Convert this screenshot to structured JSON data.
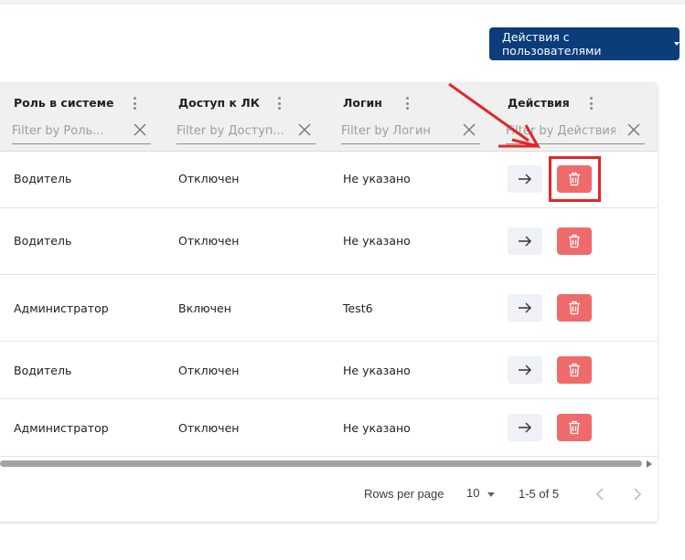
{
  "header": {
    "actions_label": "Действия с пользователями"
  },
  "table": {
    "columns": [
      {
        "title": "Роль в системе",
        "filter_placeholder": "Filter by Роль..."
      },
      {
        "title": "Доступ к ЛК",
        "filter_placeholder": "Filter by Доступ..."
      },
      {
        "title": "Логин",
        "filter_placeholder": "Filter by Логин"
      },
      {
        "title": "Действия",
        "filter_placeholder": "Filter by Действия"
      }
    ],
    "rows": [
      {
        "role": "Водитель",
        "access": "Отключен",
        "login": "Не указано"
      },
      {
        "role": "Водитель",
        "access": "Отключен",
        "login": "Не указано"
      },
      {
        "role": "Администратор",
        "access": "Включен",
        "login": "Test6"
      },
      {
        "role": "Водитель",
        "access": "Отключен",
        "login": "Не указано"
      },
      {
        "role": "Администратор",
        "access": "Отключен",
        "login": "Не указано"
      }
    ],
    "icons": {
      "menu": "kebab-menu-icon",
      "clear": "close-icon",
      "open": "arrow-right-icon",
      "delete": "trash-icon"
    }
  },
  "footer": {
    "rows_per_page_label": "Rows per page",
    "rows_per_page_value": "10",
    "range_label": "1-5 of 5"
  },
  "colors": {
    "primary": "#0a3d7a",
    "danger": "#ef6b6b",
    "annotation": "#e32525"
  }
}
